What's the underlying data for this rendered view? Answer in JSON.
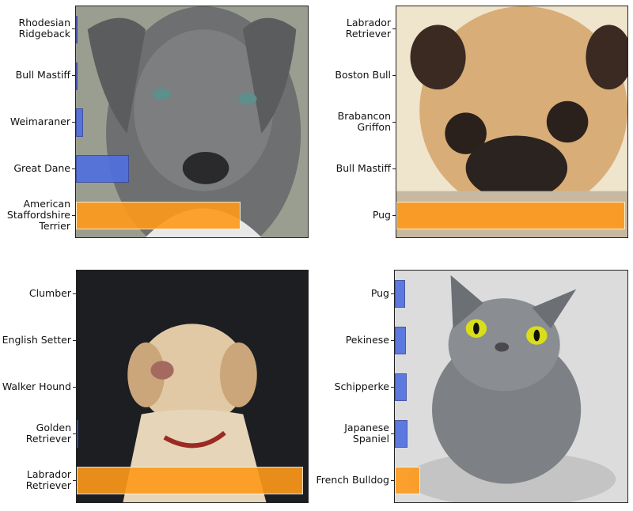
{
  "colors": {
    "bar": "#4f6fe0",
    "top_bar": "#ff9a1a"
  },
  "chart_data": [
    {
      "type": "bar",
      "orientation": "horizontal",
      "image": "grey pit bull dog",
      "categories": [
        "Rhodesian\nRidgeback",
        "Bull Mastiff",
        "Weimaraner",
        "Great Dane",
        "American\nStaffordshire\nTerrier"
      ],
      "values": [
        0.002,
        0.008,
        0.03,
        0.23,
        0.71
      ],
      "xlim": [
        0,
        1
      ]
    },
    {
      "type": "bar",
      "orientation": "horizontal",
      "image": "pug dog",
      "categories": [
        "Labrador\nRetriever",
        "Boston Bull",
        "Brabancon\nGriffon",
        "Bull Mastiff",
        "Pug"
      ],
      "values": [
        0.001,
        0.001,
        0.001,
        0.001,
        0.99
      ],
      "xlim": [
        0,
        1
      ]
    },
    {
      "type": "bar",
      "orientation": "horizontal",
      "image": "yellow labrador dog",
      "categories": [
        "Clumber",
        "English Setter",
        "Walker Hound",
        "Golden\nRetriever",
        "Labrador\nRetriever"
      ],
      "values": [
        0.0,
        0.0,
        0.0,
        0.005,
        0.98
      ],
      "xlim": [
        0,
        1
      ]
    },
    {
      "type": "bar",
      "orientation": "horizontal",
      "image": "grey cat",
      "categories": [
        "Pug",
        "Pekinese",
        "Schipperke",
        "Japanese\nSpaniel",
        "French Bulldog"
      ],
      "values": [
        0.045,
        0.048,
        0.052,
        0.055,
        0.11
      ],
      "xlim": [
        0,
        1
      ]
    }
  ]
}
